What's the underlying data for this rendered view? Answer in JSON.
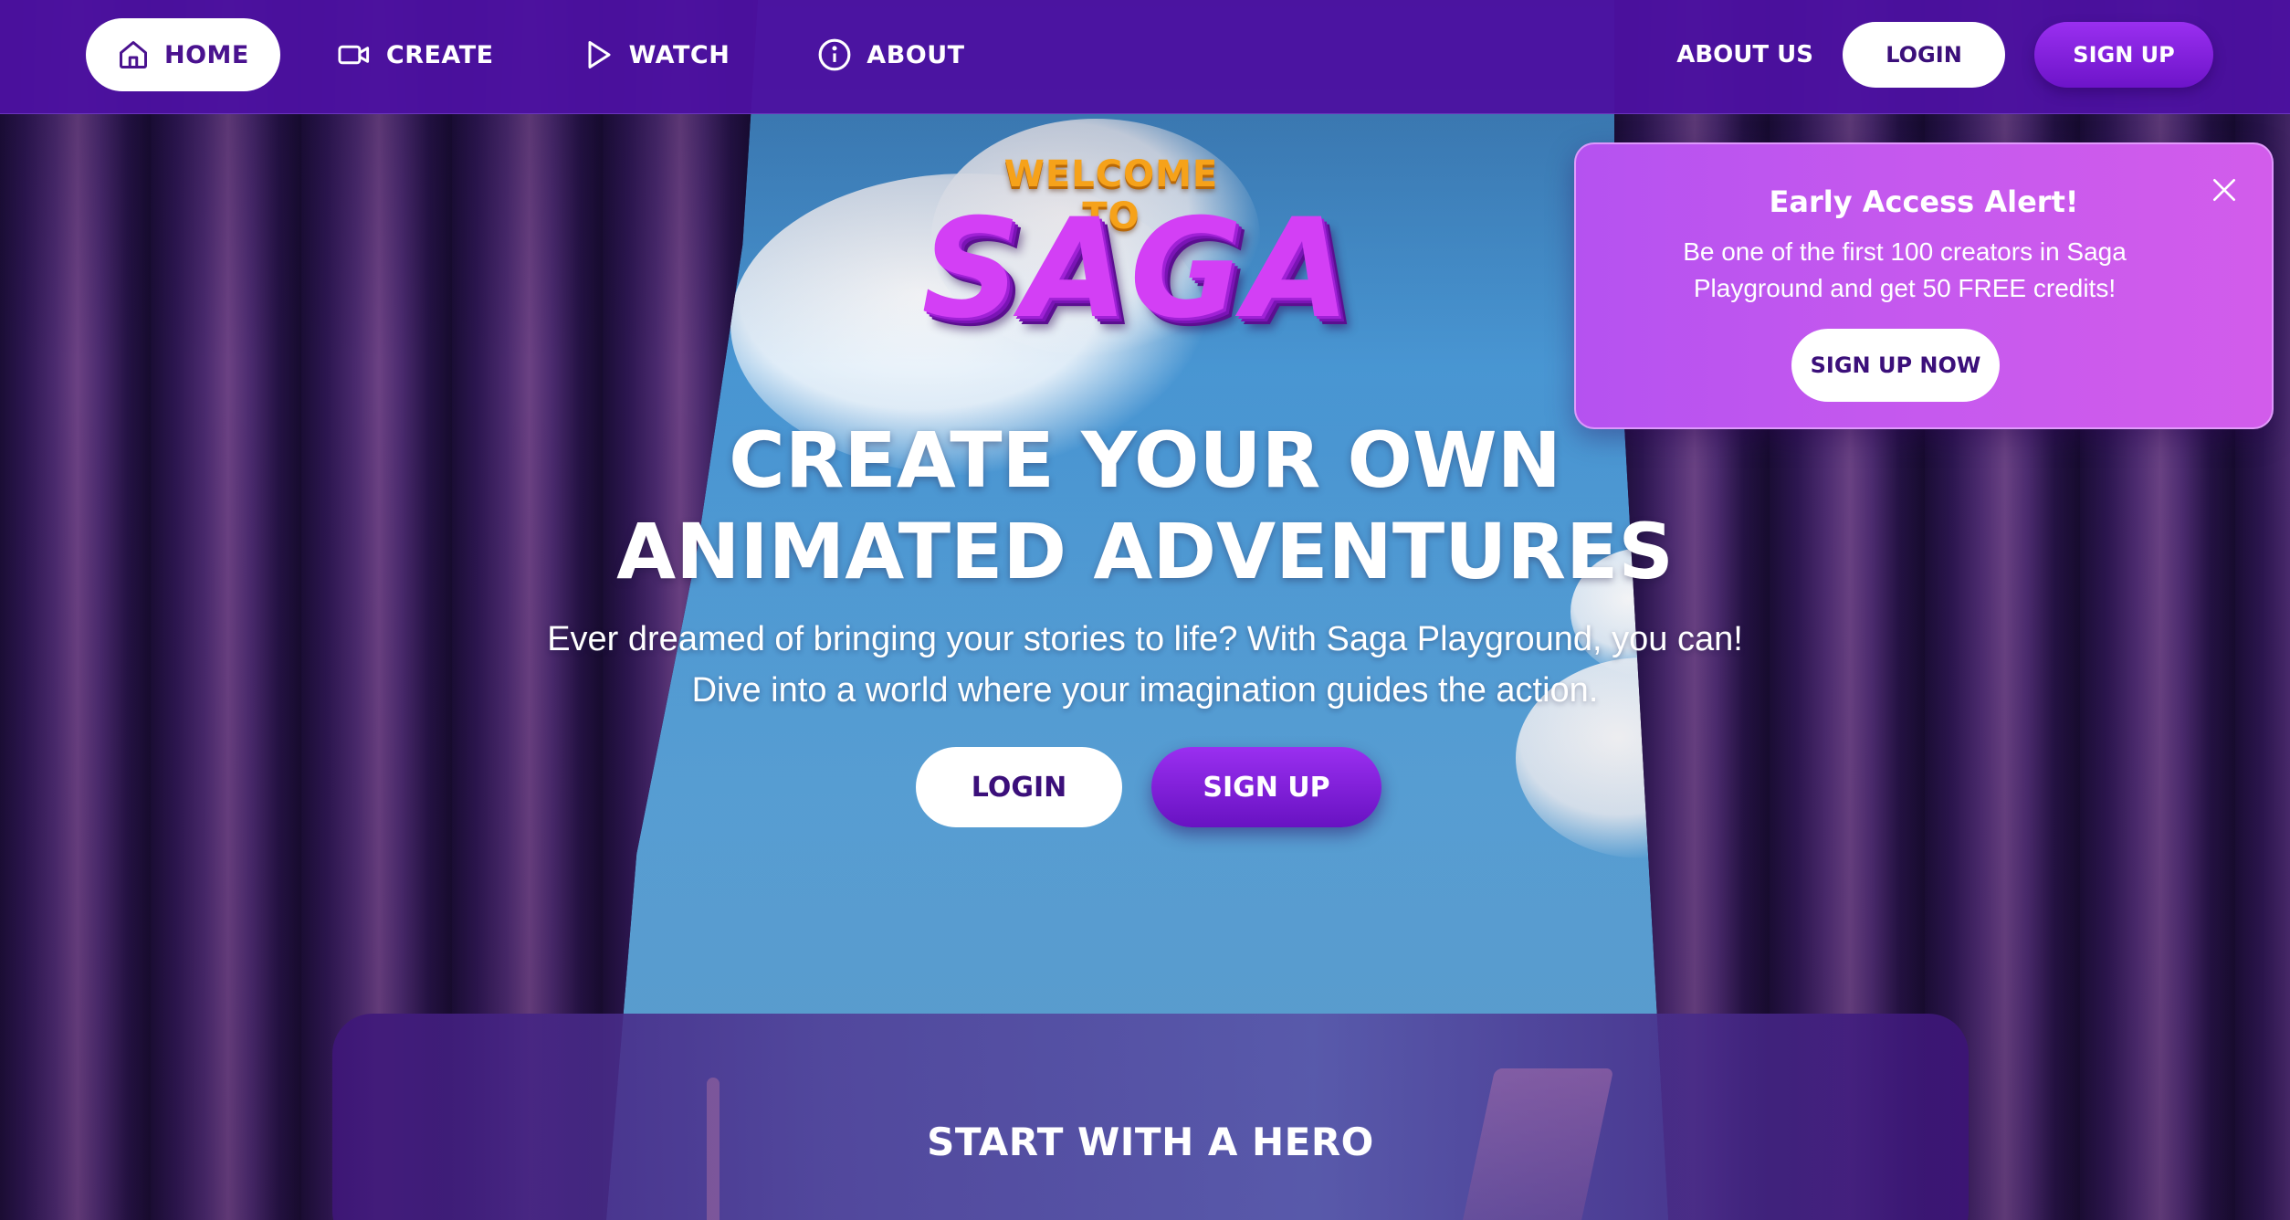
{
  "nav": {
    "items": [
      {
        "label": "HOME",
        "icon": "home-icon",
        "active": true
      },
      {
        "label": "CREATE",
        "icon": "video-camera-icon",
        "active": false
      },
      {
        "label": "WATCH",
        "icon": "play-icon",
        "active": false
      },
      {
        "label": "ABOUT",
        "icon": "info-icon",
        "active": false
      }
    ],
    "about_us": "ABOUT US",
    "login": "LOGIN",
    "signup": "SIGN UP"
  },
  "hero": {
    "welcome": "WELCOME TO",
    "brand": "SAGA",
    "headline_line1": "CREATE YOUR OWN",
    "headline_line2": "ANIMATED ADVENTURES",
    "subtitle_line1": "Ever dreamed of bringing your stories to life? With Saga Playground, you can!",
    "subtitle_line2": "Dive into a world where your imagination guides the action.",
    "login": "LOGIN",
    "signup": "SIGN UP"
  },
  "alert": {
    "title": "Early Access Alert!",
    "body": "Be one of the first 100 creators in Saga Playground and get 50 FREE credits!",
    "button": "SIGN UP NOW",
    "close_icon": "close-icon"
  },
  "section": {
    "title": "START WITH A HERO"
  },
  "colors": {
    "nav_bg": "#4c11a0",
    "accent_purple": "#9a2ff0",
    "alert_bg": "#c659ee",
    "text_dark": "#3b0f7a"
  }
}
